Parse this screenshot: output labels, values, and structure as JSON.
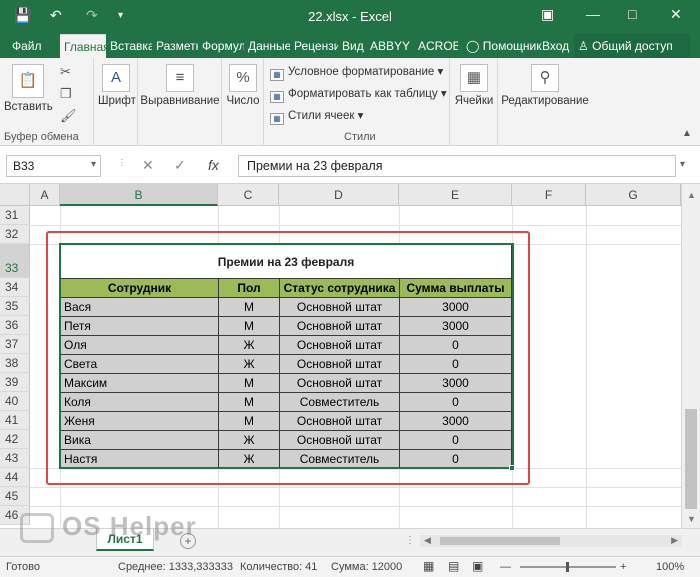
{
  "window": {
    "title": "22.xlsx - Excel"
  },
  "quick_access": {
    "save_icon": "save-icon",
    "undo_icon": "undo-icon",
    "redo_icon": "redo-icon",
    "customize_icon": "chevron-down-icon"
  },
  "window_controls": {
    "ribbon_display": "ribbon-display-icon",
    "minimize": "minimize-icon",
    "maximize": "maximize-icon",
    "close": "close-icon"
  },
  "tabs": [
    {
      "label": "Файл"
    },
    {
      "label": "Главная"
    },
    {
      "label": "Вставка"
    },
    {
      "label": "Разметка"
    },
    {
      "label": "Формулы"
    },
    {
      "label": "Данные"
    },
    {
      "label": "Рецензирование"
    },
    {
      "label": "Вид"
    },
    {
      "label": "ABBYY FineReader"
    },
    {
      "label": "ACROBAT"
    },
    {
      "label": "Помощник"
    },
    {
      "label": "Вход"
    },
    {
      "label": "Общий доступ"
    }
  ],
  "ribbon": {
    "clipboard": {
      "paste": "Вставить",
      "group": "Буфер обмена"
    },
    "font": "Шрифт",
    "alignment": "Выравнивание",
    "number": "Число",
    "styles": {
      "conditional": "Условное форматирование",
      "format_table": "Форматировать как таблицу",
      "cell_styles": "Стили ячеек",
      "group": "Стили"
    },
    "cells": "Ячейки",
    "editing": "Редактирование"
  },
  "formula_bar": {
    "name_box": "B33",
    "cancel": "✕",
    "enter": "✓",
    "fx": "fx",
    "content": "Премии на 23 февраля"
  },
  "grid": {
    "columns": [
      "A",
      "B",
      "C",
      "D",
      "E",
      "F",
      "G"
    ],
    "rows": [
      "31",
      "32",
      "33",
      "34",
      "35",
      "36",
      "37",
      "38",
      "39",
      "40",
      "41",
      "42",
      "43",
      "44",
      "45",
      "46"
    ]
  },
  "table": {
    "title": "Премии на 23 февраля",
    "headers": [
      "Сотрудник",
      "Пол",
      "Статус сотрудника",
      "Сумма выплаты"
    ],
    "rows": [
      [
        "Вася",
        "М",
        "Основной штат",
        "3000"
      ],
      [
        "Петя",
        "М",
        "Основной штат",
        "3000"
      ],
      [
        "Оля",
        "Ж",
        "Основной штат",
        "0"
      ],
      [
        "Света",
        "Ж",
        "Основной штат",
        "0"
      ],
      [
        "Максим",
        "М",
        "Основной штат",
        "3000"
      ],
      [
        "Коля",
        "М",
        "Совместитель",
        "0"
      ],
      [
        "Женя",
        "М",
        "Основной штат",
        "3000"
      ],
      [
        "Вика",
        "Ж",
        "Основной штат",
        "0"
      ],
      [
        "Настя",
        "Ж",
        "Совместитель",
        "0"
      ]
    ]
  },
  "sheets": [
    {
      "label": "Лист1"
    }
  ],
  "status": {
    "ready": "Готово",
    "average": "Среднее: 1333,333333",
    "count": "Количество: 41",
    "sum": "Сумма: 12000",
    "zoom": "100%"
  },
  "watermark": "OS Helper",
  "colors": {
    "excel_green": "#217346",
    "header_fill": "#9bbb59",
    "cell_fill": "#d0d0d0",
    "highlight_frame": "#e0454b"
  }
}
